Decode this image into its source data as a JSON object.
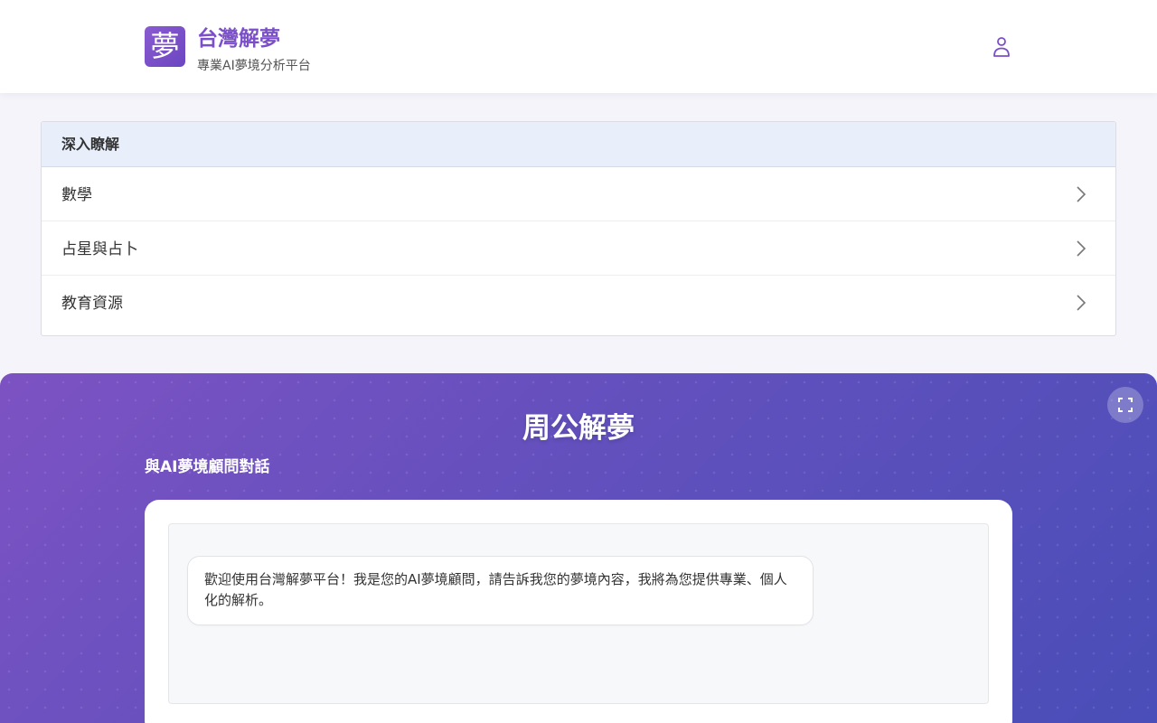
{
  "header": {
    "logo_char": "夢",
    "title": "台灣解夢",
    "subtitle": "專業AI夢境分析平台",
    "user_icon": "user-icon"
  },
  "deep_panel": {
    "heading": "深入瞭解",
    "items": [
      {
        "label": "數學",
        "icon": "chevron-right-icon"
      },
      {
        "label": "占星與占卜",
        "icon": "chevron-right-icon"
      },
      {
        "label": "教育資源",
        "icon": "chevron-right-icon"
      }
    ]
  },
  "chat": {
    "title": "周公解夢",
    "subtitle": "與AI夢境顧問對話",
    "fullscreen_icon": "fullscreen-icon",
    "welcome_message": "歡迎使用台灣解夢平台！我是您的AI夢境顧問，請告訴我您的夢境內容，我將為您提供專業、個人化的解析。"
  },
  "colors": {
    "brand": "#7b4fc9",
    "panel_head_bg": "#e8effb",
    "chat_gradient_start": "#7d52c3",
    "chat_gradient_end": "#4a4eb8"
  }
}
